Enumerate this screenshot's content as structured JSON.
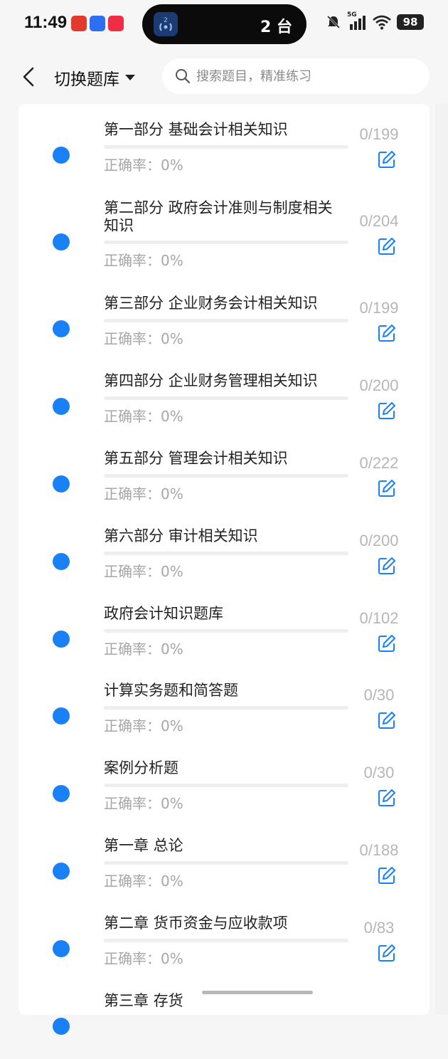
{
  "status_bar": {
    "time": "11:49",
    "island_text": "2 台",
    "island_badge": "2",
    "network": "5G",
    "battery": "98"
  },
  "header": {
    "title": "切换题库",
    "search_placeholder": "搜索题目，精准练习"
  },
  "colors": {
    "accent": "#1a80f5",
    "muted": "#a6a6a6"
  },
  "items": [
    {
      "title": "第一部分 基础会计相关知识",
      "accuracy": "正确率：0%",
      "count": "0/199",
      "progress": 0
    },
    {
      "title": "第二部分 政府会计准则与制度相关知识",
      "accuracy": "正确率：0%",
      "count": "0/204",
      "progress": 0
    },
    {
      "title": "第三部分 企业财务会计相关知识",
      "accuracy": "正确率：0%",
      "count": "0/199",
      "progress": 0
    },
    {
      "title": "第四部分 企业财务管理相关知识",
      "accuracy": "正确率：0%",
      "count": "0/200",
      "progress": 0
    },
    {
      "title": "第五部分 管理会计相关知识",
      "accuracy": "正确率：0%",
      "count": "0/222",
      "progress": 0
    },
    {
      "title": "第六部分 审计相关知识",
      "accuracy": "正确率：0%",
      "count": "0/200",
      "progress": 0
    },
    {
      "title": "政府会计知识题库",
      "accuracy": "正确率：0%",
      "count": "0/102",
      "progress": 0
    },
    {
      "title": "计算实务题和简答题",
      "accuracy": "正确率：0%",
      "count": "0/30",
      "progress": 0
    },
    {
      "title": "案例分析题",
      "accuracy": "正确率：0%",
      "count": "0/30",
      "progress": 0
    },
    {
      "title": "第一章 总论",
      "accuracy": "正确率：0%",
      "count": "0/188",
      "progress": 0
    },
    {
      "title": "第二章 货币资金与应收款项",
      "accuracy": "正确率：0%",
      "count": "0/83",
      "progress": 0
    },
    {
      "title": "第三章 存货",
      "accuracy": "",
      "count": "",
      "progress": 0
    }
  ]
}
